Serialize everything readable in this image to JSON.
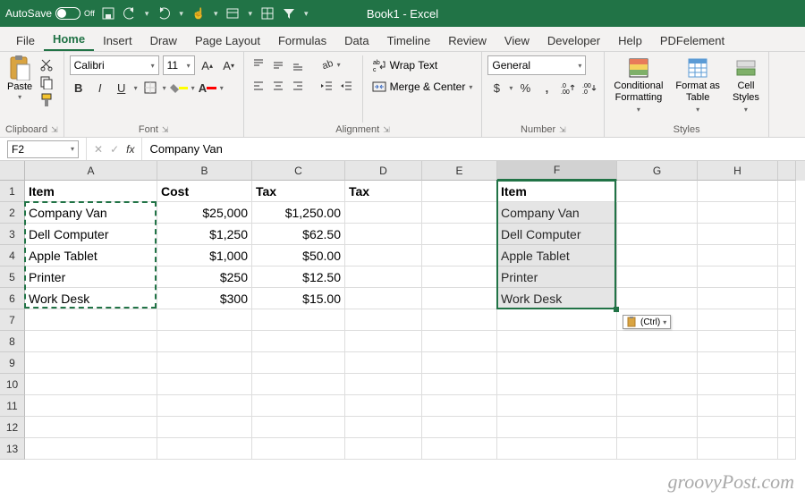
{
  "titlebar": {
    "autosave": "AutoSave",
    "autosave_state": "Off",
    "title": "Book1 - Excel"
  },
  "tabs": [
    "File",
    "Home",
    "Insert",
    "Draw",
    "Page Layout",
    "Formulas",
    "Data",
    "Timeline",
    "Review",
    "View",
    "Developer",
    "Help",
    "PDFelement"
  ],
  "active_tab": "Home",
  "ribbon": {
    "clipboard": {
      "paste": "Paste",
      "label": "Clipboard"
    },
    "font": {
      "name": "Calibri",
      "size": "11",
      "label": "Font"
    },
    "alignment": {
      "wrap": "Wrap Text",
      "merge": "Merge & Center",
      "label": "Alignment"
    },
    "number": {
      "format": "General",
      "label": "Number"
    },
    "styles": {
      "cond": "Conditional\nFormatting",
      "fmt": "Format as\nTable",
      "cell": "Cell\nStyles",
      "label": "Styles"
    }
  },
  "formula_bar": {
    "cell_ref": "F2",
    "value": "Company Van"
  },
  "columns": [
    "A",
    "B",
    "C",
    "D",
    "E",
    "F",
    "G",
    "H"
  ],
  "rows": [
    1,
    2,
    3,
    4,
    5,
    6,
    7,
    8,
    9,
    10,
    11,
    12,
    13
  ],
  "sheet": {
    "A1": "Item",
    "B1": "Cost",
    "C1": "Tax",
    "D1": "Tax",
    "F1": "Item",
    "A2": "Company Van",
    "B2": "$25,000",
    "C2": "$1,250.00",
    "F2": "Company Van",
    "A3": "Dell Computer",
    "B3": "$1,250",
    "C3": "$62.50",
    "F3": "Dell Computer",
    "A4": "Apple Tablet",
    "B4": "$1,000",
    "C4": "$50.00",
    "F4": "Apple Tablet",
    "A5": "Printer",
    "B5": "$250",
    "C5": "$12.50",
    "F5": "Printer",
    "A6": "Work Desk",
    "B6": "$300",
    "C6": "$15.00",
    "F6": "Work Desk"
  },
  "smart_tag": "(Ctrl)",
  "watermark": "groovyPost.com"
}
